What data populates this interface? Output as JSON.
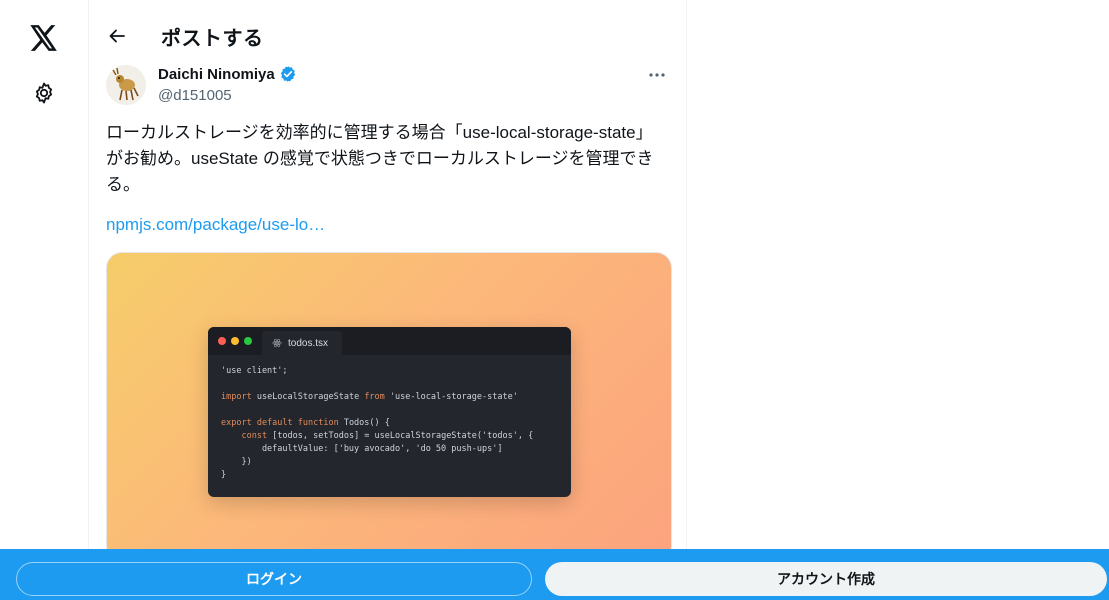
{
  "nav": {
    "logo_icon": "x-logo-icon",
    "settings_icon": "gear-icon"
  },
  "header": {
    "title": "ポストする",
    "back_icon": "arrow-left-icon"
  },
  "post": {
    "author": {
      "display_name": "Daichi Ninomiya",
      "handle": "@d151005",
      "verified": true
    },
    "text_lines": [
      "ローカルストレージを効率的に管理する場合「use-local-storage-state」",
      "がお勧め。useState の感覚で状態つきでローカルストレージを管理でき",
      "る。"
    ],
    "link_text": "npmjs.com/package/use-lo…",
    "media": {
      "tab_title": "todos.tsx",
      "code_lines": [
        "'use client';",
        "",
        "import useLocalStorageState from 'use-local-storage-state'",
        "",
        "export default function Todos() {",
        "    const [todos, setTodos] = useLocalStorageState('todos', {",
        "        defaultValue: ['buy avocado', 'do 50 push-ups']",
        "    })",
        "}"
      ]
    }
  },
  "bottom_bar": {
    "login_label": "ログイン",
    "signup_label": "アカウント作成",
    "color": "#1d9bf0"
  }
}
